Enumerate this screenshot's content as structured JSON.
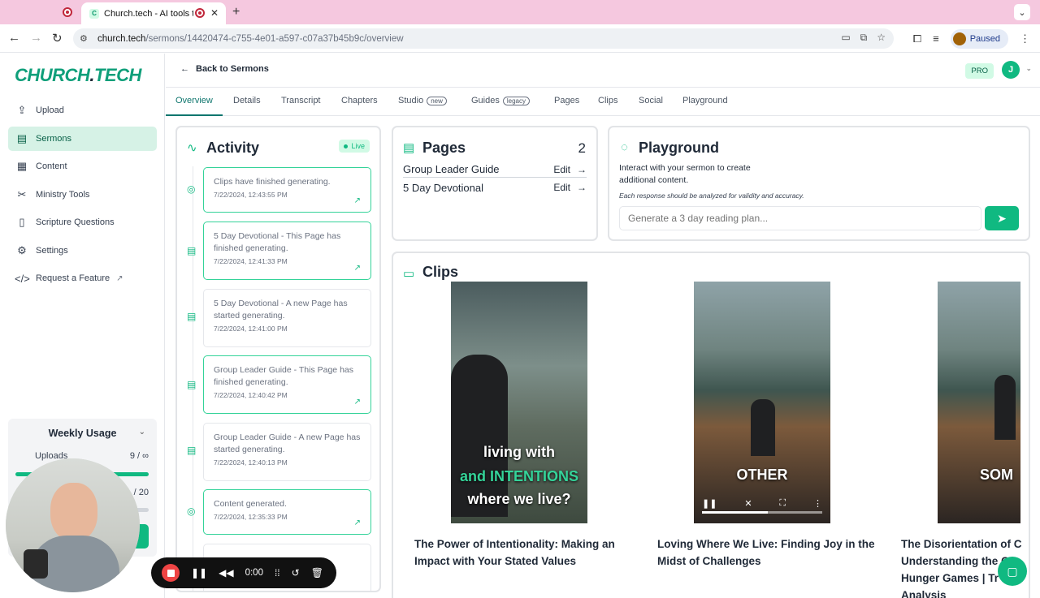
{
  "browser": {
    "tab_title": "Church.tech - AI tools tha",
    "favicon_letter": "C",
    "url_host": "church.tech",
    "url_path": "/sermons/14420474-c755-4e01-a597-c07a37b45b9c/overview",
    "profile_status": "Paused"
  },
  "sidebar": {
    "logo_main": "CHURCH",
    "logo_dot": ".",
    "logo_tail": "TECH",
    "items": [
      {
        "label": "Upload",
        "icon": "upload-icon"
      },
      {
        "label": "Sermons",
        "icon": "chat-icon",
        "active": true
      },
      {
        "label": "Content",
        "icon": "content-icon"
      },
      {
        "label": "Ministry Tools",
        "icon": "tools-icon"
      },
      {
        "label": "Scripture Questions",
        "icon": "book-icon"
      },
      {
        "label": "Settings",
        "icon": "gear-icon"
      },
      {
        "label": "Request a Feature",
        "icon": "code-icon",
        "external": "↗"
      }
    ],
    "usage": {
      "title": "Weekly Usage",
      "uploads_label": "Uploads",
      "uploads_value": "9 / ∞",
      "second_value": "/ 20"
    }
  },
  "header": {
    "back_label": "Back to Sermons",
    "plan_badge": "PRO",
    "avatar_letter": "J"
  },
  "tabs": [
    {
      "label": "Overview",
      "active": true
    },
    {
      "label": "Details"
    },
    {
      "label": "Transcript"
    },
    {
      "label": "Chapters"
    },
    {
      "label": "Studio",
      "pill": "new"
    },
    {
      "label": "Guides",
      "pill": "legacy"
    },
    {
      "label": "Pages"
    },
    {
      "label": "Clips"
    },
    {
      "label": "Social"
    },
    {
      "label": "Playground"
    }
  ],
  "activity": {
    "title": "Activity",
    "live_label": "Live",
    "items": [
      {
        "text": "Clips have finished generating.",
        "time": "7/22/2024, 12:43:55 PM",
        "icon": "check-circle-icon",
        "finished": true
      },
      {
        "text": "5 Day Devotional - This Page has finished generating.",
        "time": "7/22/2024, 12:41:33 PM",
        "icon": "document-icon",
        "finished": true
      },
      {
        "text": "5 Day Devotional - A new Page has started generating.",
        "time": "7/22/2024, 12:41:00 PM",
        "icon": "document-icon",
        "finished": false
      },
      {
        "text": "Group Leader Guide - This Page has finished generating.",
        "time": "7/22/2024, 12:40:42 PM",
        "icon": "document-icon",
        "finished": true
      },
      {
        "text": "Group Leader Guide - A new Page has started generating.",
        "time": "7/22/2024, 12:40:13 PM",
        "icon": "document-icon",
        "finished": false
      },
      {
        "text": "Content generated.",
        "time": "7/22/2024, 12:35:33 PM",
        "icon": "check-circle-icon",
        "finished": true
      }
    ]
  },
  "pages": {
    "title": "Pages",
    "count": "2",
    "edit_label": "Edit",
    "items": [
      "Group Leader Guide",
      "5 Day Devotional"
    ]
  },
  "playground": {
    "title": "Playground",
    "description": "Interact with your sermon to create additional content.",
    "note": "Each response should be analyzed for validity and accuracy.",
    "placeholder": "Generate a 3 day reading plan..."
  },
  "clips": {
    "title": "Clips",
    "items": [
      {
        "title": "The Power of Intentionality: Making an Impact with Your Stated Values",
        "caption_lines": [
          "living with",
          "and INTENTIONS",
          "where we live?"
        ]
      },
      {
        "title": "Loving Where We Live: Finding Joy in the Midst of Challenges",
        "caption_lines": [
          "OTHER"
        ]
      },
      {
        "title": "The Disorientation of C Understanding the C Hunger Games | Tr Analysis",
        "caption_lines": [
          "SOM"
        ]
      }
    ]
  },
  "recorder": {
    "time": "0:00"
  },
  "colors": {
    "brand": "#10b981",
    "brand_dark": "#0f766e",
    "tabbar": "#f5c8df",
    "record": "#ef4444"
  }
}
